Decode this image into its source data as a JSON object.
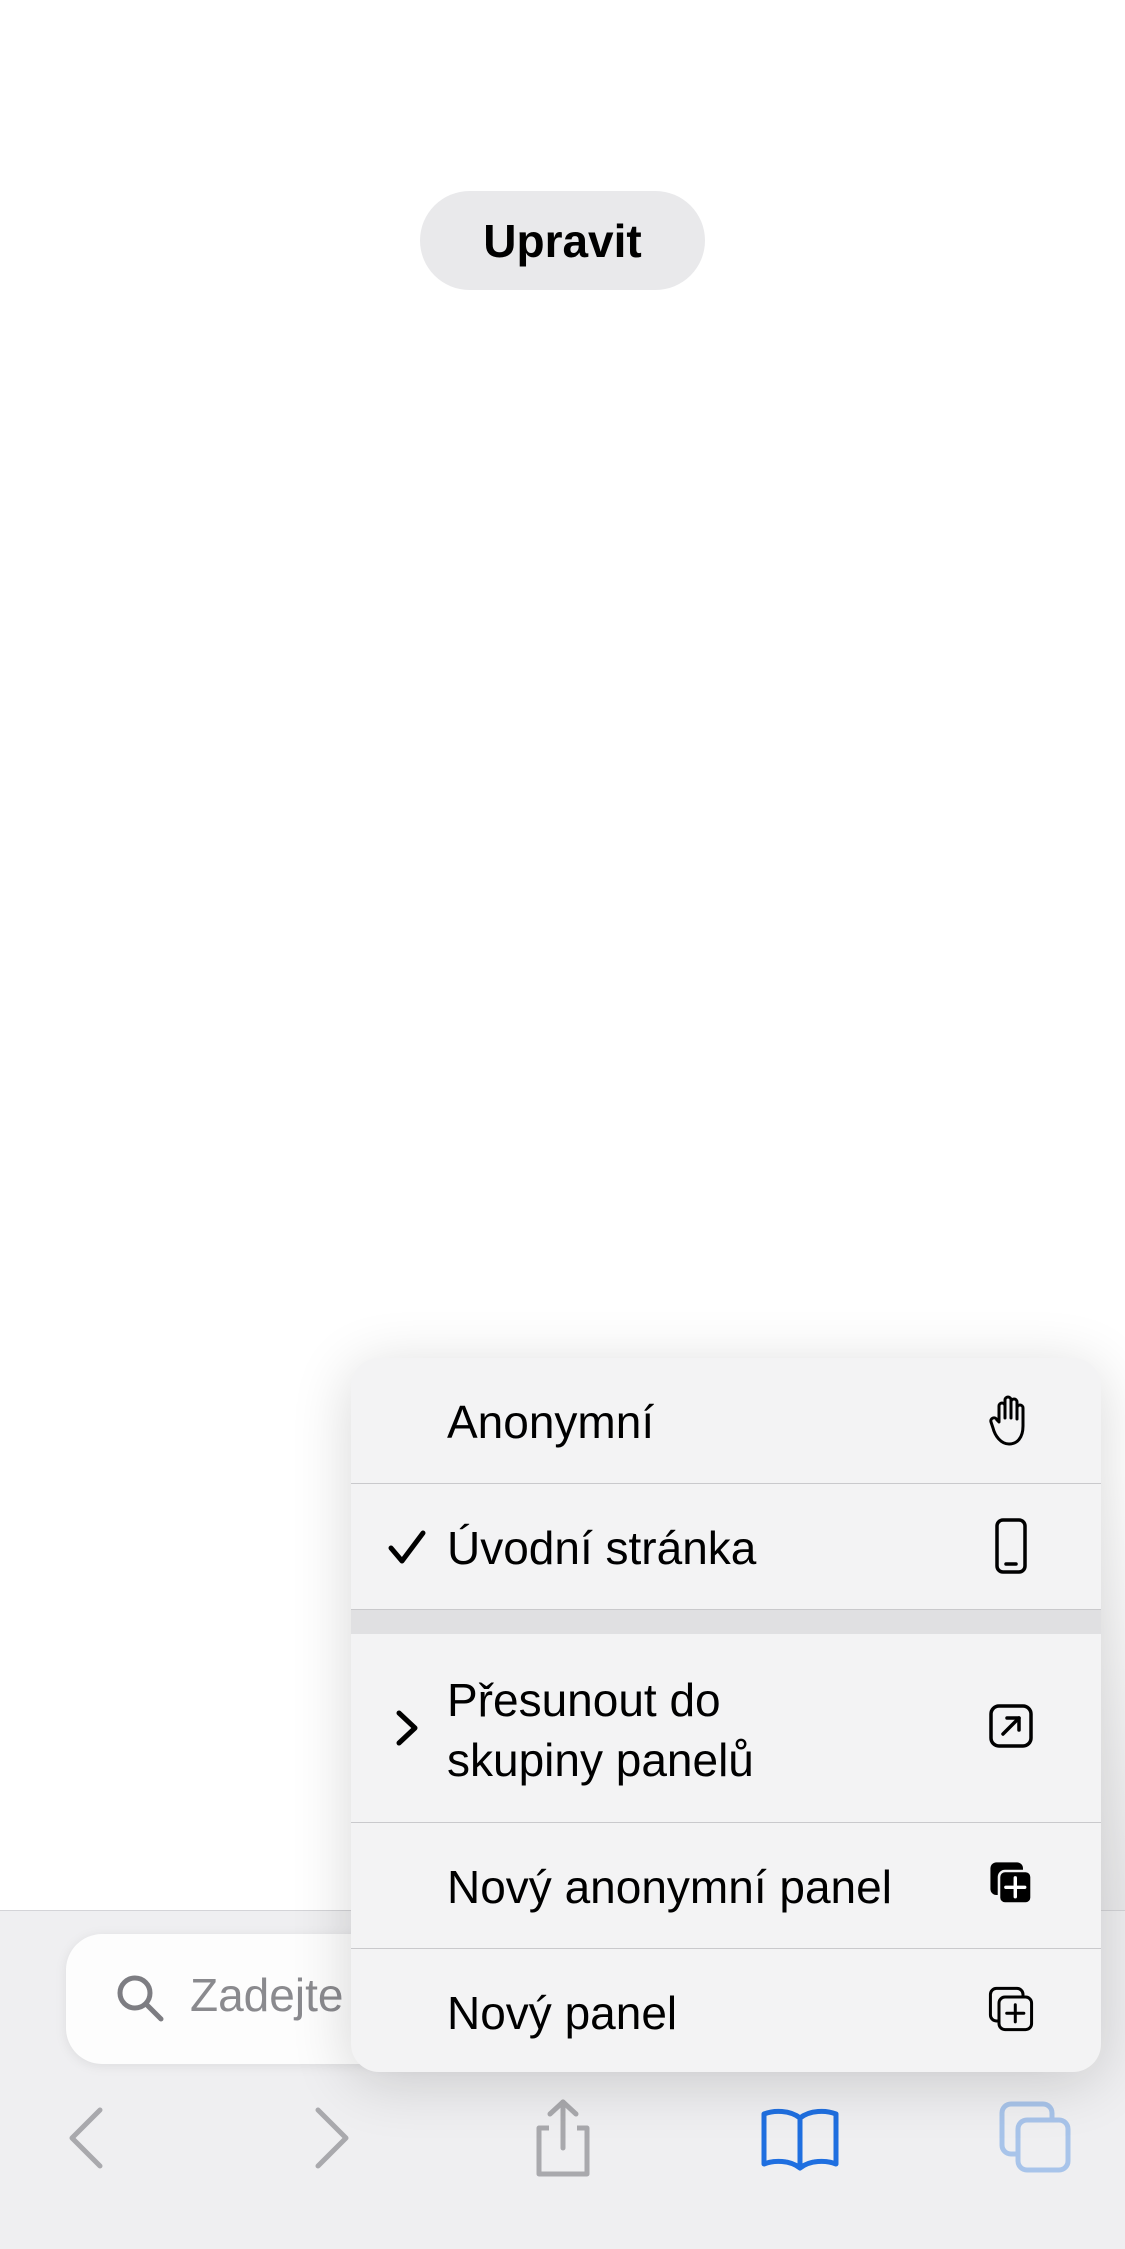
{
  "page": {
    "edit_label": "Upravit"
  },
  "menu": {
    "items": [
      {
        "label": "Anonymní",
        "icon": "hand-raised-icon",
        "checked": false
      },
      {
        "label": "Úvodní stránka",
        "icon": "iphone-icon",
        "checked": true
      },
      {
        "label_line1": "Přesunout do",
        "label_line2": "skupiny panelů",
        "icon": "arrow-up-right-square-icon",
        "submenu": true
      },
      {
        "label": "Nový anonymní panel",
        "icon": "plus-square-filled-on-square-icon"
      },
      {
        "label": "Nový panel",
        "icon": "plus-square-on-square-icon"
      }
    ]
  },
  "address_bar": {
    "placeholder": "Zadejte"
  },
  "toolbar": {
    "icons": [
      "back-icon",
      "forward-icon",
      "share-icon",
      "bookmarks-icon",
      "tabs-icon"
    ],
    "accent_color": "#1f6fe0",
    "disabled_color": "#a9a9ad"
  }
}
